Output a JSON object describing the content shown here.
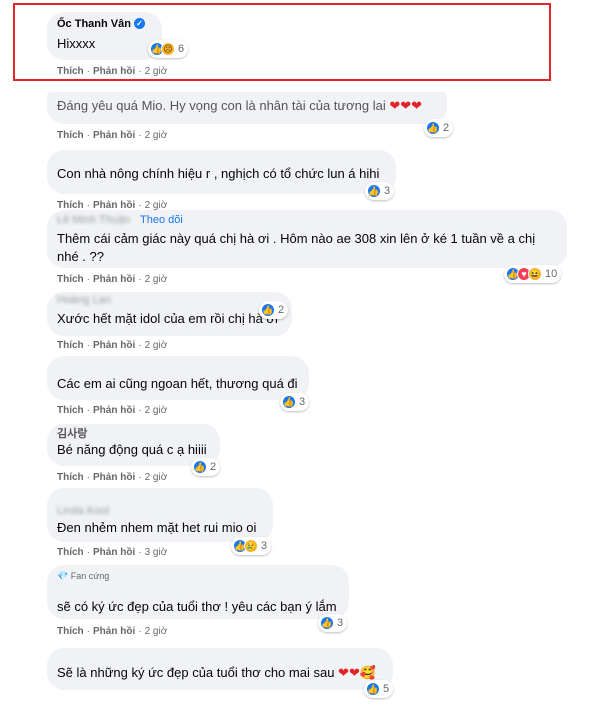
{
  "actions": {
    "like": "Thích",
    "reply": "Phản hồi",
    "sep": "·"
  },
  "comments": [
    {
      "author": "Ốc Thanh Vân",
      "text": "Hixxxx",
      "count": "6",
      "time": "2 giờ"
    },
    {
      "author": "",
      "text": "Đáng yêu quá Mio. Hy vọng con là nhân tài của tương lai",
      "emoji": "❤❤❤",
      "count": "2",
      "time": "2 giờ"
    },
    {
      "author": "",
      "text": "Con nhà nông chính hiệu r , nghịch có tổ chức lun á hihi",
      "count": "3",
      "time": "2 giờ"
    },
    {
      "author": "Lê Minh Thuận",
      "follow": "Theo dõi",
      "text1": "Thêm cái cảm giác này quá chị hà ơi . Hôm nào ae 308 xin lên ở ké 1 tuần về a chị",
      "text2": "nhé . ??",
      "count": "10",
      "time": "2 giờ"
    },
    {
      "author": "Hoàng Lan",
      "text": "Xước hết mặt idol của em rồi chị hà ơi",
      "count": "2",
      "time": "2 giờ"
    },
    {
      "author": "",
      "text": "Các em ai cũng ngoan hết, thương quá đi",
      "count": "3",
      "time": "2 giờ"
    },
    {
      "author": "김사랑",
      "text": "Bé năng động quá c ạ hiiii",
      "count": "2",
      "time": "2 giờ"
    },
    {
      "author": "Linda Kool",
      "text": "Đen nhẻm nhem mặt het rui mio oi",
      "count": "3",
      "time": "3 giờ"
    },
    {
      "author": "",
      "badge": "Fan cứng",
      "text": "sẽ có ký ức đẹp của tuổi thơ ! yêu các bạn ý lắm",
      "count": "3",
      "time": "2 giờ"
    },
    {
      "author": "",
      "text": "Sẽ là những ký ức đẹp của tuổi thơ cho mai sau",
      "emoji": "❤❤🥰",
      "count": "5",
      "time": ""
    }
  ],
  "colors": {
    "highlight": "#e0242b",
    "bubble": "#f0f2f5",
    "link": "#1877f2"
  }
}
